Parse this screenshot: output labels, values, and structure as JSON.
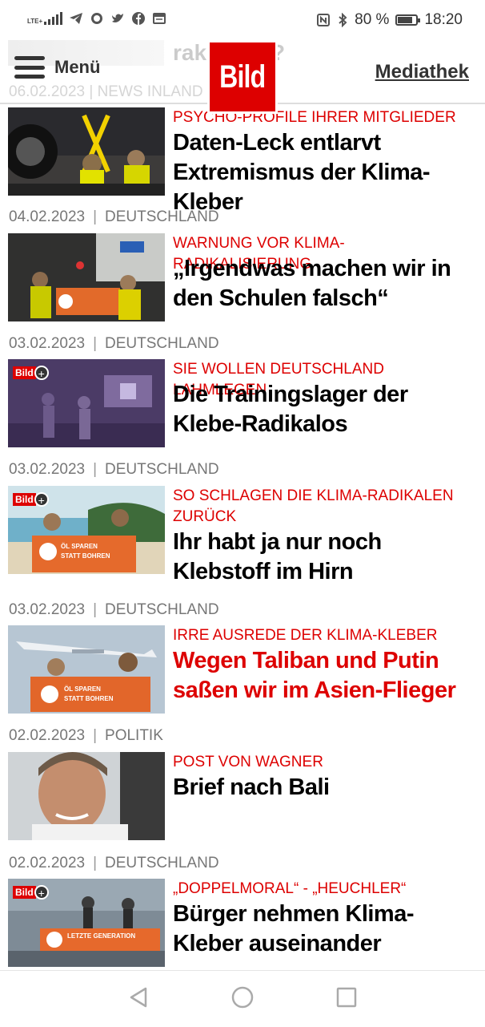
{
  "status_bar": {
    "network": "LTE+",
    "battery_percent": "80 %",
    "battery_level": 0.8,
    "time": "18:20",
    "icons": [
      "signal-icon",
      "telegram-icon",
      "whatsapp-icon",
      "twitter-icon",
      "facebook-icon",
      "news-icon",
      "nfc-icon",
      "bluetooth-icon",
      "battery-icon"
    ]
  },
  "header": {
    "menu_label": "Menü",
    "logo_text": "Bild",
    "mediathek_label": "Mediathek",
    "brand_color": "#dd0000"
  },
  "partial_article": {
    "title_fragment": "rake (1/5)?",
    "meta": "06.02.2023 | NEWS INLAND"
  },
  "articles": [
    {
      "kicker": "PSYCHO-PROFILE IHRER MITGLIEDER",
      "headline": "Daten-Leck entlarvt Extremismus der Klima-Kleber",
      "headline_color": "black",
      "bild_plus": false
    },
    {
      "date": "04.02.2023",
      "category": "DEUTSCHLAND",
      "kicker": "WARNUNG VOR KLIMA-RADIKALISIERUNG",
      "headline": "„Irgendwas machen wir in den Schulen falsch“",
      "headline_color": "black",
      "bild_plus": false
    },
    {
      "date": "03.02.2023",
      "category": "DEUTSCHLAND",
      "kicker": "SIE WOLLEN DEUTSCHLAND LAHMLEGEN",
      "headline": "Die Trainingslager der Klebe-Radikalos",
      "headline_color": "black",
      "bild_plus": true
    },
    {
      "date": "03.02.2023",
      "category": "DEUTSCHLAND",
      "kicker": "SO SCHLAGEN DIE KLIMA-RADIKALEN ZURÜCK",
      "headline": "Ihr habt ja nur noch Klebstoff im Hirn",
      "headline_color": "black",
      "bild_plus": true
    },
    {
      "date": "03.02.2023",
      "category": "DEUTSCHLAND",
      "kicker": "IRRE AUSREDE DER KLIMA-KLEBER",
      "headline": "Wegen Taliban und Putin saßen wir im Asien-Flieger",
      "headline_color": "red",
      "bild_plus": false
    },
    {
      "date": "02.02.2023",
      "category": "POLITIK",
      "kicker": "POST VON WAGNER",
      "headline": "Brief nach Bali",
      "headline_color": "black",
      "bild_plus": false
    },
    {
      "date": "02.02.2023",
      "category": "DEUTSCHLAND",
      "kicker": "„DOPPELMORAL“ - „HEUCHLER“",
      "headline": "Bürger nehmen Klima-Kleber auseinander",
      "headline_color": "black",
      "bild_plus": true
    }
  ],
  "badge": {
    "bild_label": "Bild",
    "plus_symbol": "+"
  },
  "meta_separator": "|",
  "thumbnail_overlays": {
    "protest_sign_1": "ÖL SPAREN",
    "protest_sign_2": "STATT BOHREN",
    "banner_text": "LETZTE GENERATION"
  }
}
